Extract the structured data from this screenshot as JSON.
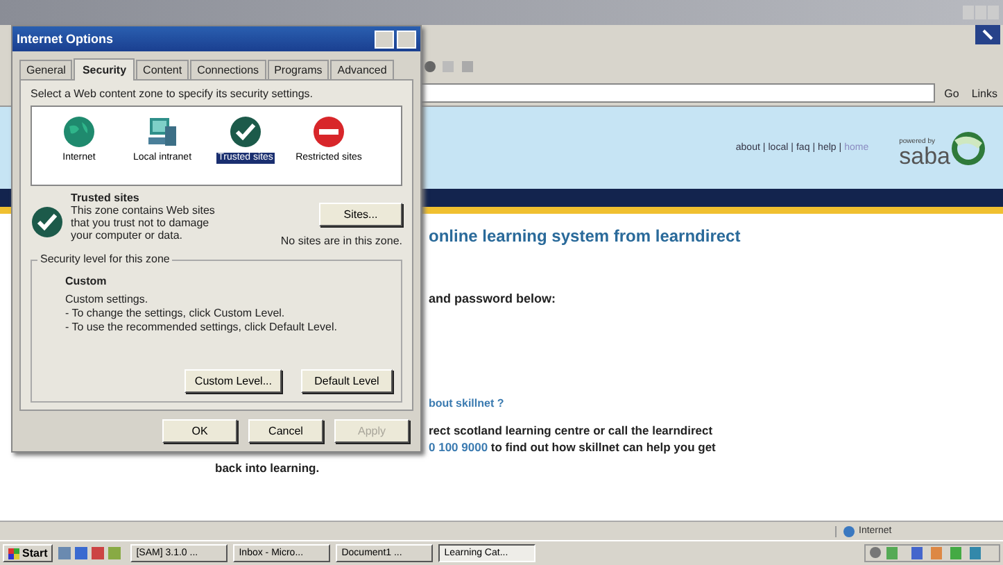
{
  "browser": {
    "go_button": "Go",
    "links_button": "Links",
    "header": {
      "nav": [
        {
          "kind": "link",
          "label": "about"
        },
        {
          "kind": "separator",
          "label": "|"
        },
        {
          "kind": "link",
          "label": "local"
        },
        {
          "kind": "separator",
          "label": "|"
        },
        {
          "kind": "link",
          "label": "faq"
        },
        {
          "kind": "separator",
          "label": "|"
        },
        {
          "kind": "link",
          "label": "help"
        },
        {
          "kind": "separator",
          "label": "|"
        },
        {
          "kind": "link",
          "label": "home"
        }
      ],
      "powered_by": "powered by",
      "logo": "saba"
    },
    "content": {
      "heading": "online learning system from learndirect",
      "prompt": "and password below:",
      "question_link": "bout skillnet ?",
      "paragraph": {
        "before": "rect scotland learning centre or call the learndirect",
        "link": "0 100 9000",
        "after": "to find out how skillnet can help you get"
      },
      "continuation": "back into learning."
    },
    "status_bar": {
      "zone": "Internet"
    }
  },
  "dialog": {
    "title": "Internet Options",
    "tabs": [
      {
        "label": "General",
        "selected": false
      },
      {
        "label": "Security",
        "selected": true
      },
      {
        "label": "Content",
        "selected": false
      },
      {
        "label": "Connections",
        "selected": false
      },
      {
        "label": "Programs",
        "selected": false
      },
      {
        "label": "Advanced",
        "selected": false
      }
    ],
    "instruction": "Select a Web content zone to specify its security settings.",
    "zones": [
      {
        "kind": "globe",
        "label": "Internet",
        "selected": false
      },
      {
        "kind": "computer",
        "label": "Local intranet",
        "selected": false
      },
      {
        "kind": "check",
        "label": "Trusted sites",
        "selected": true
      },
      {
        "kind": "blocked",
        "label": "Restricted sites",
        "selected": false
      }
    ],
    "zone_title": "Trusted sites",
    "zone_description": "This zone contains Web sites that you trust not to damage your computer or data.",
    "sites_button": "Sites...",
    "sites_note": "No sites are in this zone.",
    "level_group": "Security level for this zone",
    "level_name": "Custom",
    "level_lines": [
      "Custom settings.",
      "- To change the settings, click Custom Level.",
      "- To use the recommended settings, click Default Level."
    ],
    "level_buttons": [
      "Custom Level...",
      "Default Level"
    ],
    "buttons": [
      {
        "label": "OK",
        "disabled": false
      },
      {
        "label": "Cancel",
        "disabled": false
      },
      {
        "label": "Apply",
        "disabled": true
      }
    ]
  },
  "taskbar": {
    "start": "Start",
    "tasks": [
      {
        "label": "[SAM] 3.1.0 ...",
        "selected": false
      },
      {
        "label": "Inbox - Micro...",
        "selected": false
      },
      {
        "label": "Document1 ...",
        "selected": false
      },
      {
        "label": "Learning Cat...",
        "selected": true
      }
    ]
  }
}
